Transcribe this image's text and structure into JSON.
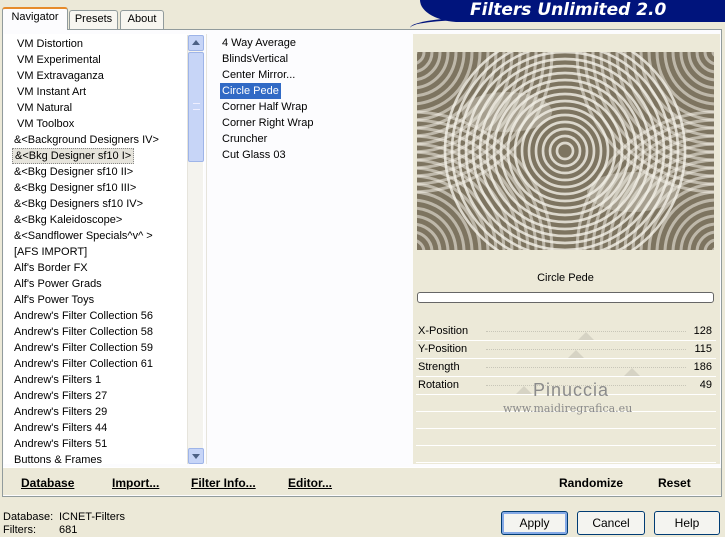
{
  "app": {
    "title": "Filters Unlimited 2.0"
  },
  "tabs": [
    {
      "label": "Navigator",
      "active": true
    },
    {
      "label": "Presets",
      "active": false
    },
    {
      "label": "About",
      "active": false
    }
  ],
  "categories": [
    "VM Distortion",
    "VM Experimental",
    "VM Extravaganza",
    "VM Instant Art",
    "VM Natural",
    "VM Toolbox",
    "&<Background Designers IV>",
    "&<Bkg Designer sf10 I>",
    "&<Bkg Designer sf10 II>",
    "&<Bkg Designer sf10 III>",
    "&<Bkg Designers sf10 IV>",
    "&<Bkg Kaleidoscope>",
    "&<Sandflower Specials^v^ >",
    "[AFS IMPORT]",
    "Alf's Border FX",
    "Alf's Power Grads",
    "Alf's Power Toys",
    "Andrew's Filter Collection 56",
    "Andrew's Filter Collection 58",
    "Andrew's Filter Collection 59",
    "Andrew's Filter Collection 61",
    "Andrew's Filters 1",
    "Andrew's Filters 27",
    "Andrew's Filters 29",
    "Andrew's Filters 44",
    "Andrew's Filters 51",
    "Buttons & Frames"
  ],
  "selected_category": "&<Bkg Designer sf10 I>",
  "filters": [
    "4 Way Average",
    "BlindsVertical",
    "Center Mirror...",
    "Circle Pede",
    "Corner Half Wrap",
    "Corner Right Wrap",
    "Cruncher",
    "Cut Glass 03"
  ],
  "selected_filter": "Circle Pede",
  "preview": {
    "filter_name": "Circle Pede",
    "colors": {
      "dark": "#7d7460",
      "light": "#f4f1e8"
    }
  },
  "params": [
    {
      "label": "X-Position",
      "value": "128",
      "level": 128
    },
    {
      "label": "Y-Position",
      "value": "115",
      "level": 115
    },
    {
      "label": "Strength",
      "value": "186",
      "level": 186
    },
    {
      "label": "Rotation",
      "value": "49",
      "level": 49
    }
  ],
  "watermark": {
    "name": "Pinuccia",
    "site": "www.maidiregrafica.eu"
  },
  "bottom_buttons": [
    {
      "label": "Database",
      "name": "database-button"
    },
    {
      "label": "Import...",
      "name": "import-button"
    },
    {
      "label": "Filter Info...",
      "name": "filter-info-button"
    },
    {
      "label": "Editor...",
      "name": "editor-button"
    },
    {
      "label": "Randomize",
      "name": "randomize-button"
    },
    {
      "label": "Reset",
      "name": "reset-button"
    }
  ],
  "status": {
    "database_label": "Database:",
    "database_value": "ICNET-Filters",
    "filters_label": "Filters:",
    "filters_value": "681"
  },
  "dialog_buttons": {
    "apply": "Apply",
    "cancel": "Cancel",
    "help": "Help"
  }
}
